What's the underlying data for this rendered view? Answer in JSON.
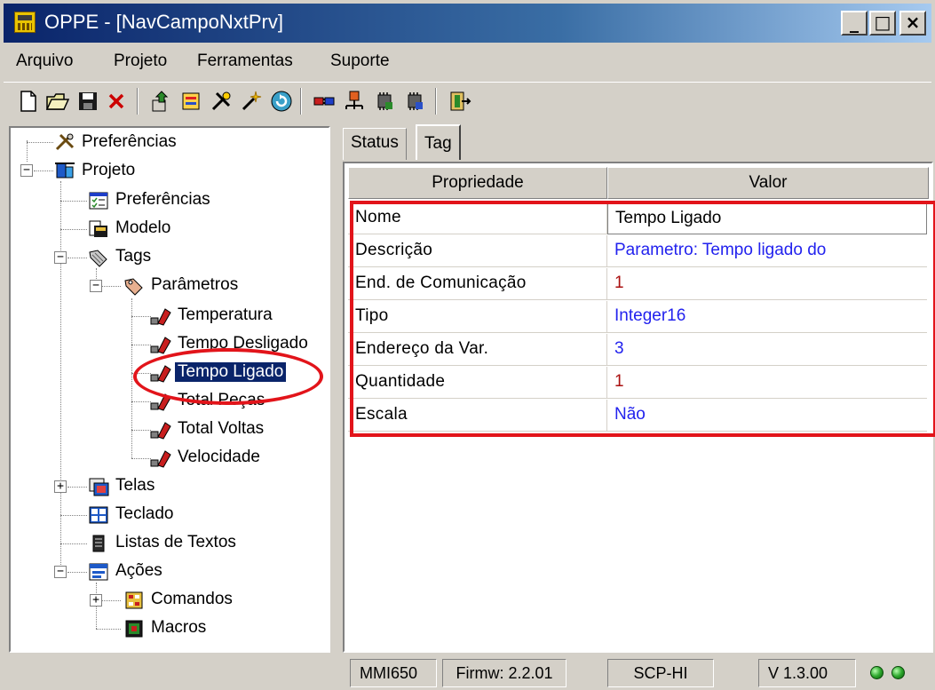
{
  "window": {
    "title": "OPPE - [NavCampoNxtPrv]",
    "controls": {
      "minimize": "_",
      "maximize": "□",
      "close": "×"
    }
  },
  "menu": {
    "items": [
      {
        "label": "Arquivo"
      },
      {
        "label": "Projeto"
      },
      {
        "label": "Ferramentas"
      },
      {
        "label": "Suporte"
      }
    ]
  },
  "toolbar": {
    "buttons": [
      {
        "icon": "new-document-icon"
      },
      {
        "icon": "open-folder-icon"
      },
      {
        "icon": "save-icon"
      },
      {
        "icon": "delete-icon"
      },
      {
        "icon": "upload-icon"
      },
      {
        "icon": "download-icon"
      },
      {
        "icon": "tools-icon"
      },
      {
        "icon": "wand-icon"
      },
      {
        "icon": "refresh-icon"
      },
      {
        "icon": "connect-icon"
      },
      {
        "icon": "network-icon"
      },
      {
        "icon": "chip-icon"
      },
      {
        "icon": "chip-settings-icon"
      },
      {
        "icon": "exit-icon"
      }
    ]
  },
  "tree": {
    "nodes": [
      {
        "label": "Preferências",
        "icon": "tools-icon"
      },
      {
        "label": "Projeto",
        "icon": "project-icon",
        "expander": "−"
      },
      {
        "label": "Preferências",
        "icon": "checklist-icon"
      },
      {
        "label": "Modelo",
        "icon": "model-icon"
      },
      {
        "label": "Tags",
        "icon": "tags-icon",
        "expander": "−"
      },
      {
        "label": "Parâmetros",
        "icon": "parameters-icon",
        "expander": "−"
      },
      {
        "label": "Temperatura",
        "icon": "tag-item-icon"
      },
      {
        "label": "Tempo Desligado",
        "icon": "tag-item-icon"
      },
      {
        "label": "Tempo Ligado",
        "icon": "tag-item-icon",
        "selected": true
      },
      {
        "label": "Total Peças",
        "icon": "tag-item-icon"
      },
      {
        "label": "Total Voltas",
        "icon": "tag-item-icon"
      },
      {
        "label": "Velocidade",
        "icon": "tag-item-icon"
      },
      {
        "label": "Telas",
        "icon": "screens-icon",
        "expander": "+"
      },
      {
        "label": "Teclado",
        "icon": "keyboard-icon"
      },
      {
        "label": "Listas de Textos",
        "icon": "text-list-icon"
      },
      {
        "label": "Ações",
        "icon": "actions-icon",
        "expander": "−"
      },
      {
        "label": "Comandos",
        "icon": "commands-icon",
        "expander": "+"
      },
      {
        "label": "Macros",
        "icon": "macros-icon"
      }
    ]
  },
  "tabs": [
    {
      "label": "Status"
    },
    {
      "label": "Tag"
    }
  ],
  "grid": {
    "headers": [
      "Propriedade",
      "Valor"
    ],
    "rows": [
      {
        "property": "Nome",
        "value": "Tempo Ligado",
        "value_color": "#000000"
      },
      {
        "property": "Descrição",
        "value": "Parametro: Tempo ligado do",
        "value_color": "#2222ee"
      },
      {
        "property": "End. de Comunicação",
        "value": "1",
        "value_color": "#aa1010"
      },
      {
        "property": "Tipo",
        "value": "Integer16",
        "value_color": "#2222ee"
      },
      {
        "property": "Endereço da Var.",
        "value": "3",
        "value_color": "#2222ee"
      },
      {
        "property": "Quantidade",
        "value": "1",
        "value_color": "#aa1010"
      },
      {
        "property": "Escala",
        "value": "Não",
        "value_color": "#2222ee"
      }
    ]
  },
  "statusbar": {
    "model": "MMI650",
    "firmware": "Firmw: 2.2.01",
    "protocol": "SCP-HI",
    "version": "V 1.3.00"
  },
  "colors": {
    "title_bar": "#0a246a",
    "selection": "#0a246a",
    "annotation": "#e2141a",
    "status_led": "#2ea82e"
  }
}
